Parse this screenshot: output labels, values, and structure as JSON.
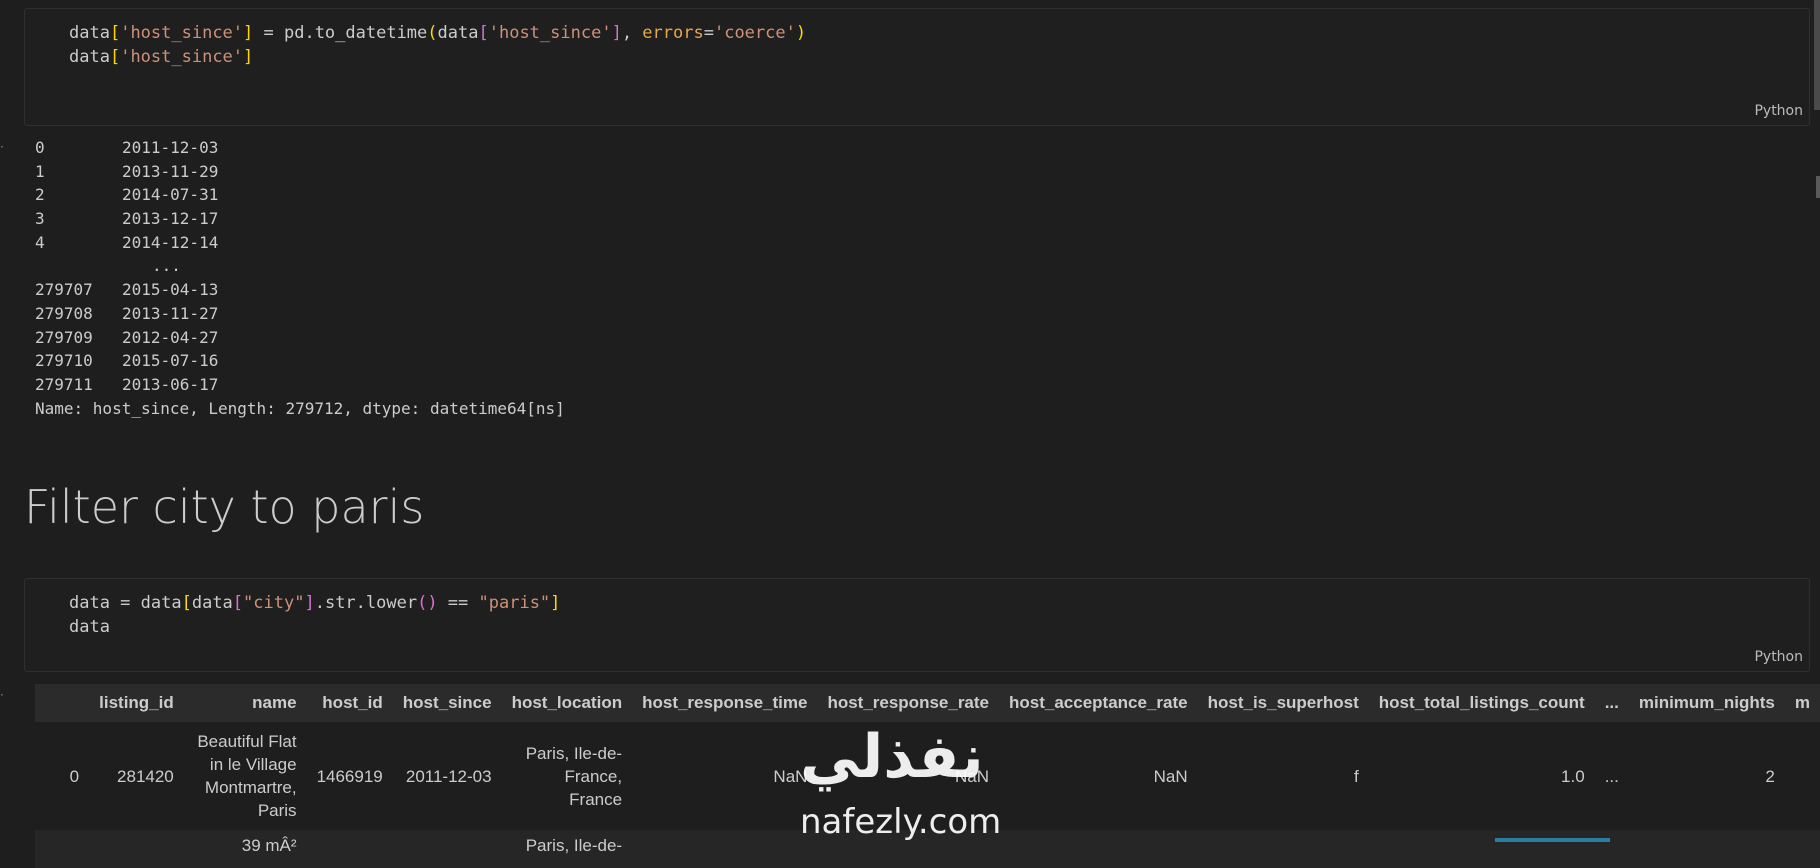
{
  "cell1": {
    "line1": {
      "a": "data",
      "b1": "[",
      "s1": "'host_since'",
      "b2": "]",
      "c": " = pd.to_datetime",
      "b3": "(",
      "d": "data",
      "b4": "[",
      "s2": "'host_since'",
      "b5": "]",
      "e": ", ",
      "kw": "errors",
      "f": "=",
      "s3": "'coerce'",
      "b6": ")"
    },
    "line2": {
      "a": "data",
      "b1": "[",
      "s1": "'host_since'",
      "b2": "]"
    },
    "lang": "Python"
  },
  "output1": {
    "rows": [
      {
        "idx": "0",
        "val": "2011-12-03"
      },
      {
        "idx": "1",
        "val": "2013-11-29"
      },
      {
        "idx": "2",
        "val": "2014-07-31"
      },
      {
        "idx": "3",
        "val": "2013-12-17"
      },
      {
        "idx": "4",
        "val": "2014-12-14"
      }
    ],
    "ellipsis": "...",
    "rows2": [
      {
        "idx": "279707",
        "val": "2015-04-13"
      },
      {
        "idx": "279708",
        "val": "2013-11-27"
      },
      {
        "idx": "279709",
        "val": "2012-04-27"
      },
      {
        "idx": "279710",
        "val": "2015-07-16"
      },
      {
        "idx": "279711",
        "val": "2013-06-17"
      }
    ],
    "footer": "Name: host_since, Length: 279712, dtype: datetime64[ns]"
  },
  "heading": "Filter city to paris",
  "cell2": {
    "line1": {
      "a": "data = data",
      "b1": "[",
      "b": "data",
      "b2": "[",
      "s1": "\"city\"",
      "b3": "]",
      "c": ".str.lower",
      "b4": "()",
      "d": " == ",
      "s2": "\"paris\"",
      "b5": "]"
    },
    "line2": "data",
    "lang": "Python"
  },
  "table": {
    "columns": [
      "",
      "listing_id",
      "name",
      "host_id",
      "host_since",
      "host_location",
      "host_response_time",
      "host_response_rate",
      "host_acceptance_rate",
      "host_is_superhost",
      "host_total_listings_count",
      "...",
      "minimum_nights",
      "m"
    ],
    "row0": [
      "0",
      "281420",
      "Beautiful Flat in le Village Montmartre, Paris",
      "1466919",
      "2011-12-03",
      "Paris, Ile-de-France, France",
      "NaN",
      "NaN",
      "NaN",
      "f",
      "1.0",
      "...",
      "2"
    ],
    "row1_partial": [
      "",
      "",
      "39 mÂ²",
      "",
      "",
      "Paris, Ile-de-",
      "",
      "",
      "",
      "",
      "",
      "",
      ""
    ]
  },
  "watermark": {
    "arabic": "نفذلي",
    "latin": "nafezly.com"
  }
}
